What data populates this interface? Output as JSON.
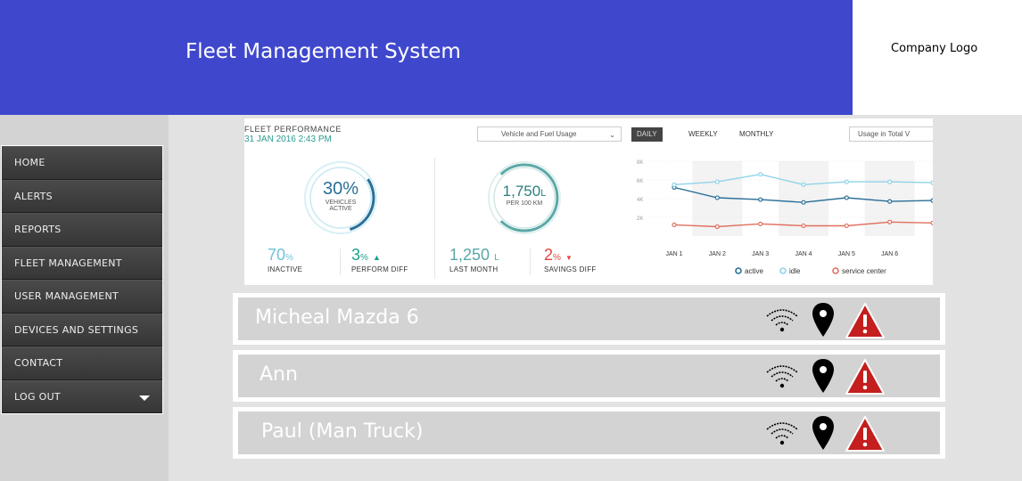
{
  "header": {
    "title": "Fleet Management System",
    "logo": "Company Logo"
  },
  "sidebar": {
    "items": [
      {
        "label": "HOME"
      },
      {
        "label": "ALERTS"
      },
      {
        "label": "REPORTS"
      },
      {
        "label": "FLEET MANAGEMENT"
      },
      {
        "label": "USER MANAGEMENT"
      },
      {
        "label": "DEVICES AND SETTINGS"
      },
      {
        "label": "CONTACT"
      },
      {
        "label": "LOG OUT",
        "icon": "caret-down-icon"
      }
    ]
  },
  "performance": {
    "title": "FLEET PERFORMANCE",
    "date": "31 JAN 2016  2:43 PM",
    "select_value": "Vehicle and Fuel Usage",
    "tabs": [
      "DAILY",
      "WEEKLY",
      "MONTHLY"
    ],
    "active_tab": "DAILY",
    "usage_select": "Usage in Total V",
    "ring1": {
      "value": "30",
      "unit": "%",
      "line1": "VEHICLES",
      "line2": "ACTIVE",
      "fraction": 0.3
    },
    "ring2": {
      "value": "1,750",
      "unit": "L",
      "line1": "PER 100 KM",
      "fraction": 0.75
    },
    "stats": [
      {
        "value": "70",
        "unit": "%",
        "label": "INACTIVE",
        "color": "#6fc3d6"
      },
      {
        "value": "3",
        "unit": "%",
        "label": "PERFORM DIFF",
        "color": "#1e9f8c",
        "arrow": "up"
      },
      {
        "value": "1,250",
        "unit": "L",
        "label": "LAST MONTH",
        "color": "#5aa7a7"
      },
      {
        "value": "2",
        "unit": "%",
        "label": "SAVINGS DIFF",
        "color": "#e0473e",
        "arrow": "down"
      }
    ],
    "colors": {
      "active": "#2a6f97",
      "idle": "#8fd3e8",
      "service": "#e07060",
      "teal": "#2a9d8f"
    }
  },
  "chart_data": {
    "type": "line",
    "x": [
      "JAN 1",
      "JAN 2",
      "JAN 3",
      "JAN 4",
      "JAN 5",
      "JAN 6"
    ],
    "ylim": [
      0,
      8000
    ],
    "yticks": [
      "8K",
      "6K",
      "4K",
      "2K"
    ],
    "series": [
      {
        "name": "active",
        "color": "#2a6f97",
        "values": [
          5200,
          4100,
          3900,
          3600,
          4100,
          3700,
          3800
        ]
      },
      {
        "name": "idle",
        "color": "#8fd3e8",
        "values": [
          5500,
          5800,
          6600,
          5500,
          5800,
          5800,
          5700
        ]
      },
      {
        "name": "service center",
        "color": "#e07060",
        "values": [
          1200,
          1000,
          1300,
          1100,
          1100,
          1500,
          1400
        ]
      }
    ]
  },
  "vehicles": [
    {
      "name": "Micheal Mazda 6"
    },
    {
      "name": "Ann"
    },
    {
      "name": "Paul (Man Truck)"
    }
  ],
  "icons": [
    "wifi-icon",
    "map-pin-icon",
    "warning-icon"
  ]
}
